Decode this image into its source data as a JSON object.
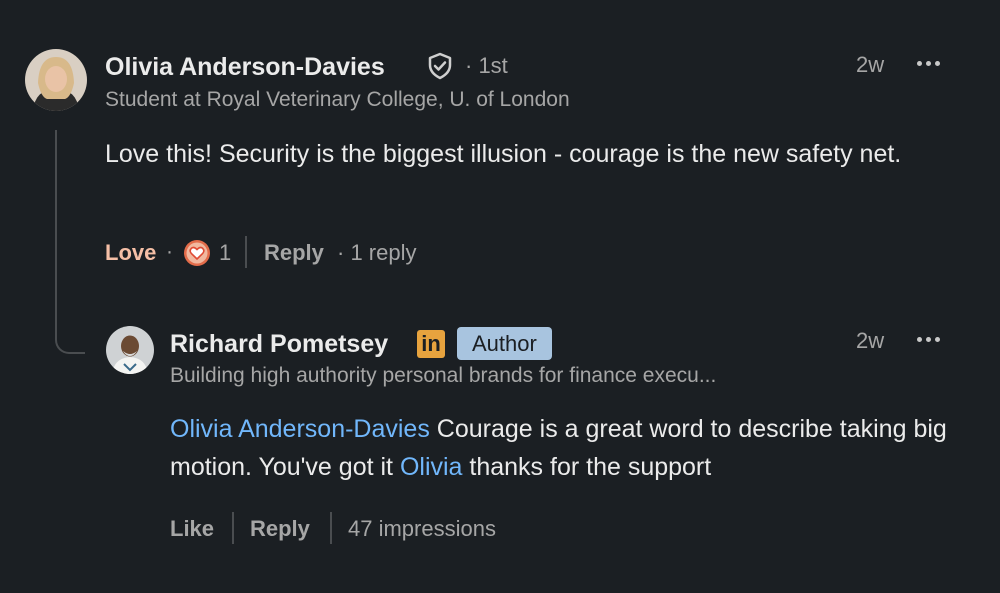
{
  "comment": {
    "author": "Olivia Anderson-Davies",
    "degree": "· 1st",
    "headline": "Student at Royal Veterinary College, U. of London",
    "time": "2w",
    "text": "Love this! Security is the biggest illusion - courage is the new safety net.",
    "reaction_label": "Love",
    "reaction_sep": "·",
    "reaction_count": "1",
    "reply_label": "Reply",
    "reply_count": "· 1 reply"
  },
  "reply": {
    "author": "Richard Pometsey",
    "linkedin_badge": "in",
    "author_badge": "Author",
    "headline": "Building high authority personal brands for finance execu...",
    "time": "2w",
    "mention1": "Olivia Anderson-Davies",
    "text1": " Courage is a great word to describe taking big motion. You've got it ",
    "mention2": "Olivia",
    "text2": " thanks for the support",
    "like_label": "Like",
    "reply_label": "Reply",
    "impressions": "47 impressions"
  },
  "icons": {
    "verified": "shield-check-icon",
    "more": "more-horizontal-icon",
    "love": "heart-reaction-icon",
    "linkedin": "linkedin-icon"
  },
  "colors": {
    "background": "#1b1f23",
    "love_accent": "#f5bfa6",
    "mention_link": "#71b7fb",
    "author_badge_bg": "#a8c4df",
    "linkedin_badge_bg": "#e7a33e"
  }
}
